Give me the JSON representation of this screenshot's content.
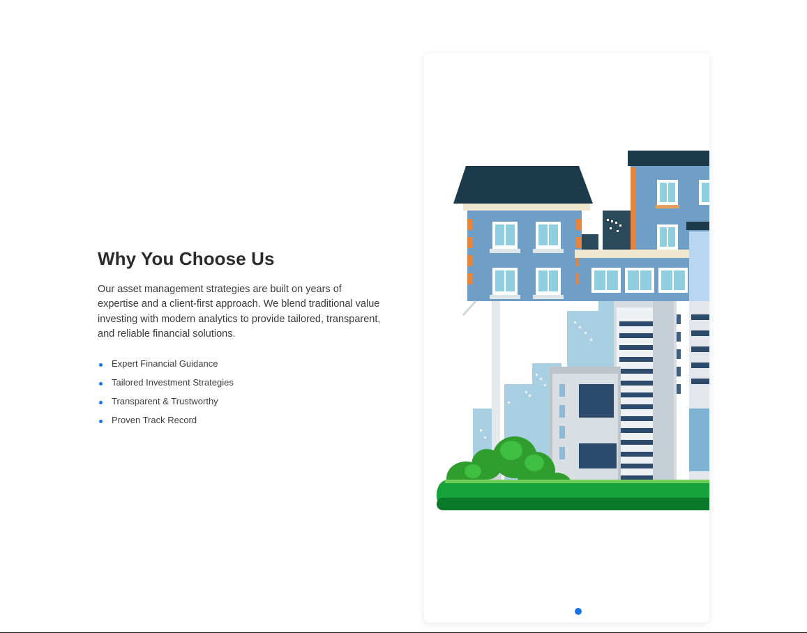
{
  "section": {
    "heading": "Why You Choose Us",
    "paragraph": "Our asset management strategies are built on years of expertise and a client-first approach. We blend traditional value investing with modern analytics to provide tailored, transparent, and reliable financial solutions.",
    "features": [
      "Expert Financial Guidance",
      "Tailored Investment Strategies",
      "Transparent & Trustworthy",
      "Proven Track Record"
    ]
  },
  "carousel": {
    "slide_count": 1,
    "active_index": 0,
    "slide_image": "city-buildings-illustration",
    "accent_color": "#1a73e8"
  }
}
